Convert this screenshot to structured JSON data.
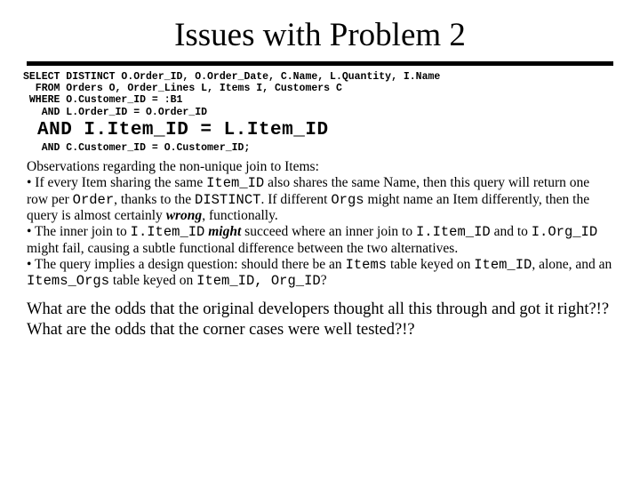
{
  "title": "Issues with Problem 2",
  "sql": {
    "line1": "SELECT DISTINCT O.Order_ID, O.Order_Date, C.Name, L.Quantity, I.Name",
    "line2": "  FROM Orders O, Order_Lines L, Items I, Customers C",
    "line3": " WHERE O.Customer_ID = :B1",
    "line4": "   AND L.Order_ID = O.Order_ID",
    "line5_em": "AND I.Item_ID = L.Item_ID",
    "line6": "   AND C.Customer_ID = O.Customer_ID;"
  },
  "obs": {
    "heading": "Observations regarding the non-unique join to Items:",
    "b1a": "• If every Item sharing the same ",
    "code_item_id": "Item_ID",
    "b1b": " also shares the same Name, then this query will return one row per ",
    "code_order": "Order",
    "b1c": ", thanks to the ",
    "code_distinct": "DISTINCT",
    "b1d": ". If different ",
    "code_orgs": "Orgs",
    "b1e": " might name an Item differently, then the query is almost certainly ",
    "wrong": "wrong",
    "b1f": ", functionally.",
    "b2a": "• The inner join to ",
    "code_iitem": "I.Item_ID",
    "might": "might",
    "b2b": " succeed where an inner join to ",
    "b2c": " and to ",
    "code_iorg": "I.Org_ID",
    "b2d": " might fail, causing a subtle functional difference between the two alternatives.",
    "b3a": "• The query implies a design question: should there be an ",
    "code_items": "Items",
    "b3b": " table keyed on ",
    "b3c": ", alone, and an ",
    "code_items_orgs": "Items_Orgs",
    "b3d": " table keyed on ",
    "code_pair": "Item_ID, Org_ID",
    "b3e": "?"
  },
  "q": {
    "l1": "What are the odds that the original developers thought all this through and got it right?!?",
    "l2": "What are the odds that the corner cases were well tested?!?"
  }
}
